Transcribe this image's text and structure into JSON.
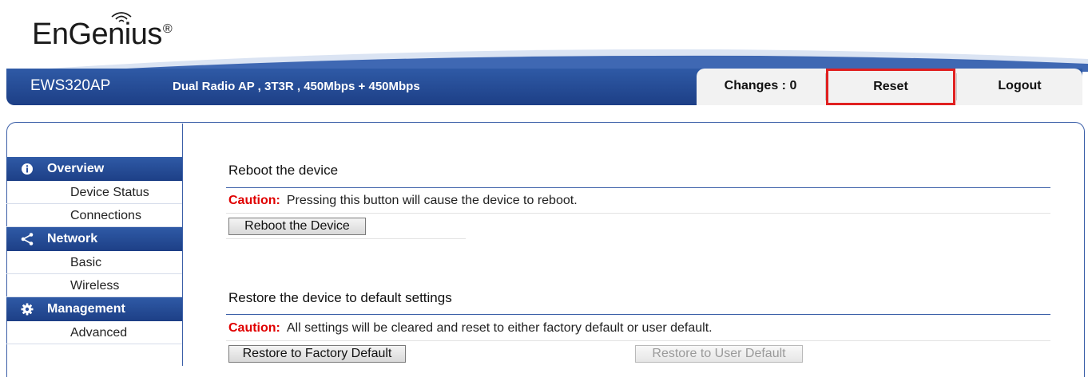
{
  "header": {
    "logo_text": "EnGenius",
    "logo_mark": "®",
    "model": "EWS320AP",
    "subtitle": "Dual Radio AP , 3T3R , 450Mbps + 450Mbps",
    "tabs": {
      "changes": "Changes : 0",
      "reset": "Reset",
      "logout": "Logout"
    },
    "highlight_color": "#e02020",
    "bar_color": "#2a4f9e"
  },
  "sidebar": {
    "sections": [
      {
        "label": "Overview",
        "icon": "info-icon",
        "items": [
          "Device Status",
          "Connections"
        ]
      },
      {
        "label": "Network",
        "icon": "share-icon",
        "items": [
          "Basic",
          "Wireless"
        ]
      },
      {
        "label": "Management",
        "icon": "gear-icon",
        "items": [
          "Advanced"
        ]
      }
    ]
  },
  "main": {
    "reboot": {
      "title": "Reboot the device",
      "caution_label": "Caution:",
      "caution_text": "Pressing this button will cause the device to reboot.",
      "button": "Reboot the Device"
    },
    "restore": {
      "title": "Restore the device to default settings",
      "caution_label": "Caution:",
      "caution_text": "All settings will be cleared and reset to either factory default or user default.",
      "factory_button": "Restore to Factory Default",
      "user_button": "Restore to User Default"
    },
    "caution_color": "#e00000"
  }
}
